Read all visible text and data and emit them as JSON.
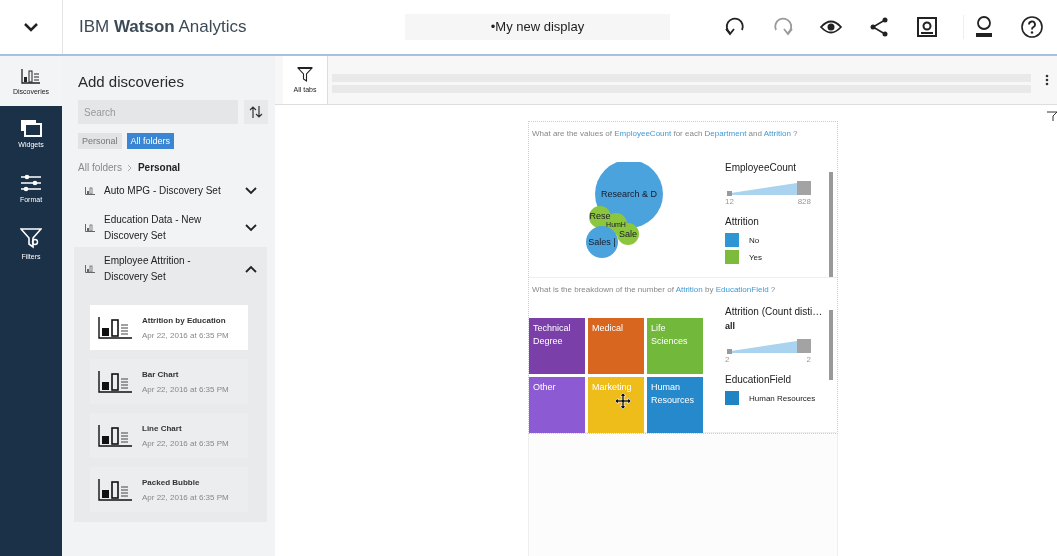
{
  "header": {
    "title": "IBM **Watson** Analytics",
    "document_title": "•My new display",
    "toolbar": [
      {
        "kind": "undo",
        "disabled": false
      },
      {
        "kind": "redo",
        "disabled": true
      },
      {
        "kind": "preview",
        "disabled": false
      },
      {
        "kind": "share",
        "disabled": false
      },
      {
        "kind": "capture",
        "disabled": false
      },
      {
        "kind": "user",
        "disabled": false
      },
      {
        "kind": "help",
        "disabled": false
      }
    ]
  },
  "rail": [
    {
      "kind": "discoveries",
      "label": "Discoveries",
      "selected": true
    },
    {
      "kind": "widgets",
      "label": "Widgets",
      "selected": false
    },
    {
      "kind": "format",
      "label": "Format",
      "selected": false
    },
    {
      "kind": "filters",
      "label": "Filters",
      "selected": false
    }
  ],
  "panel": {
    "title": "Add discoveries",
    "search": {
      "placeholder": "Search"
    },
    "filters": [
      {
        "label": "Personal",
        "selected": false
      },
      {
        "label": "All folders",
        "selected": true
      }
    ],
    "breadcrumb": [
      "All folders",
      "Personal"
    ],
    "folders": [
      {
        "name": "Auto MPG - Discovery Set",
        "expanded": false
      },
      {
        "name": "Education Data - New Discovery Set",
        "expanded": false
      },
      {
        "name": "Employee Attrition - Discovery Set",
        "expanded": true,
        "children": [
          {
            "name": "Attrition by Education",
            "date": "Apr 22, 2016 at 6:35 PM",
            "selected": true
          },
          {
            "name": "Bar Chart",
            "date": "Apr 22, 2016 at 6:35 PM",
            "selected": false
          },
          {
            "name": "Line Chart",
            "date": "Apr 22, 2016 at 6:35 PM",
            "selected": false
          },
          {
            "name": "Packed Bubble",
            "date": "Apr 22, 2016 at 6:35 PM",
            "selected": false
          }
        ]
      }
    ]
  },
  "tabs_bar": {
    "label": "All tabs"
  },
  "cards": [
    {
      "kind": "bubble",
      "question": [
        {
          "text": "What are the values of",
          "kind": "plain"
        },
        {
          "text": "EmployeeCount",
          "kind": "field"
        },
        {
          "text": "for each",
          "kind": "plain"
        },
        {
          "text": "Department",
          "kind": "field"
        },
        {
          "text": "and",
          "kind": "plain"
        },
        {
          "text": "Attrition",
          "kind": "field"
        },
        {
          "text": "?",
          "kind": "plain"
        }
      ],
      "items": [
        {
          "label": "Research & D",
          "color": "#4aa3dc"
        },
        {
          "label": "Rese",
          "color": "#8cc63f"
        },
        {
          "label": "HumH",
          "color": "#8cc63f"
        },
        {
          "label": "Sale",
          "color": "#8cc63f"
        },
        {
          "label": "Sales |",
          "color": "#4aa3dc"
        }
      ],
      "legend": {
        "size_title": "EmployeeCount",
        "min": "12",
        "max": "828",
        "color_title": "Attrition",
        "colors": [
          {
            "label": "No",
            "color": "#2e96d3"
          },
          {
            "label": "Yes",
            "color": "#7dbb3a"
          }
        ]
      }
    },
    {
      "kind": "treemap",
      "question": [
        {
          "text": "What is the breakdown of the number of",
          "kind": "plain"
        },
        {
          "text": "Attrition",
          "kind": "field"
        },
        {
          "text": "by",
          "kind": "plain"
        },
        {
          "text": "EducationField",
          "kind": "field"
        },
        {
          "text": "?",
          "kind": "plain"
        }
      ],
      "items": [
        {
          "label": "Technical Degree",
          "color": "#7a3fa8"
        },
        {
          "label": "Medical",
          "color": "#d9661f"
        },
        {
          "label": "Life Sciences",
          "color": "#72b83a"
        },
        {
          "label": "Other",
          "color": "#8c5ad3"
        },
        {
          "label": "Marketing",
          "color": "#efbd1a"
        },
        {
          "label": "Human Resources",
          "color": "#2589cc"
        }
      ],
      "legend": {
        "size_title": "Attrition (Count disti…",
        "subtitle": "all",
        "min": "2",
        "max": "2",
        "color_title": "EducationField",
        "colors": [
          {
            "label": "Human Resources",
            "color": "#1f84c4"
          }
        ]
      }
    }
  ]
}
